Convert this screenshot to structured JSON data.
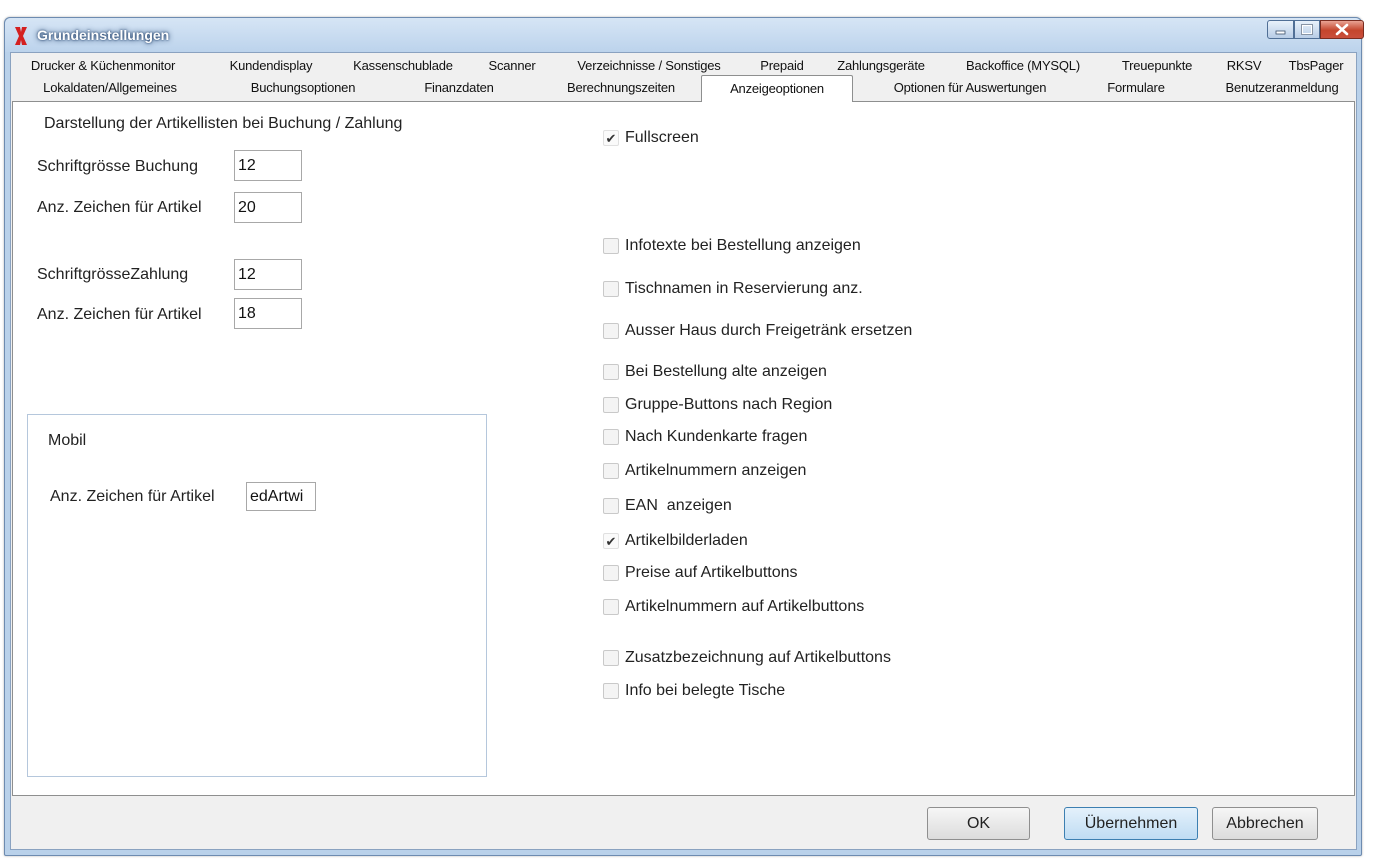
{
  "window": {
    "title": "Grundeinstellungen"
  },
  "tabs_row1": [
    "Drucker & Küchenmonitor",
    "Kundendisplay",
    "Kassenschublade",
    "Scanner",
    "Verzeichnisse / Sonstiges",
    "Prepaid",
    "Zahlungsgeräte",
    "Backoffice (MYSQL)",
    "Treuepunkte",
    "RKSV",
    "TbsPager"
  ],
  "tabs_row2": [
    "Lokaldaten/Allgemeines",
    "Buchungsoptionen",
    "Finanzdaten",
    "Berechnungszeiten",
    "Anzeigeoptionen",
    "Optionen für Auswertungen",
    "Formulare",
    "Benutzeranmeldung"
  ],
  "active_tab": "Anzeigeoptionen",
  "left": {
    "section_title": "Darstellung der Artikellisten bei Buchung / Zahlung",
    "font_size_booking_label": "Schriftgrösse Buchung",
    "font_size_booking_value": "12",
    "chars_booking_label": "Anz. Zeichen für Artikel",
    "chars_booking_value": "20",
    "font_size_payment_label": "SchriftgrösseZahlung",
    "font_size_payment_value": "12",
    "chars_payment_label": "Anz. Zeichen für Artikel",
    "chars_payment_value": "18",
    "mobil": {
      "title": "Mobil",
      "chars_label": "Anz. Zeichen für Artikel",
      "chars_value": "edArtwi"
    }
  },
  "options": [
    {
      "label": "Fullscreen",
      "checked": true
    },
    {
      "label": "Infotexte bei Bestellung anzeigen",
      "checked": false
    },
    {
      "label": "Tischnamen in Reservierung anz.",
      "checked": false
    },
    {
      "label": "Ausser Haus durch Freigetränk ersetzen",
      "checked": false
    },
    {
      "label": "Bei Bestellung alte anzeigen",
      "checked": false
    },
    {
      "label": "Gruppe-Buttons nach Region",
      "checked": false
    },
    {
      "label": "Nach Kundenkarte fragen",
      "checked": false
    },
    {
      "label": "Artikelnummern anzeigen",
      "checked": false
    },
    {
      "label": "EAN  anzeigen",
      "checked": false
    },
    {
      "label": "Artikelbilderladen",
      "checked": true
    },
    {
      "label": "Preise auf Artikelbuttons",
      "checked": false
    },
    {
      "label": "Artikelnummern auf Artikelbuttons",
      "checked": false
    },
    {
      "label": "Zusatzbezeichnung auf Artikelbuttons",
      "checked": false
    },
    {
      "label": "Info bei belegte Tische",
      "checked": false
    }
  ],
  "buttons": {
    "ok": "OK",
    "apply": "Übernehmen",
    "cancel": "Abbrechen"
  },
  "colors": {
    "title_bar": "#bcd3ec",
    "close_button": "#c4452d",
    "panel": "#ffffff",
    "default_button": "#bfdcf3"
  }
}
